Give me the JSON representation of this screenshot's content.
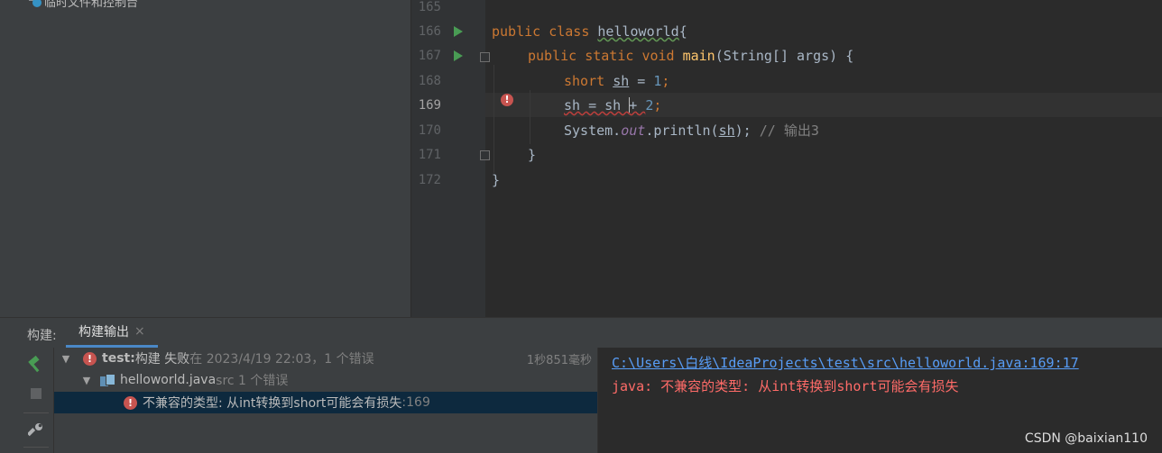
{
  "project": {
    "node_label": "临时文件和控制台"
  },
  "editor": {
    "line_numbers": [
      "165",
      "166",
      "167",
      "168",
      "169",
      "170",
      "171",
      "172"
    ],
    "current_line": "169",
    "lines": {
      "l166": {
        "kw1": "public",
        "kw2": "class",
        "name": "helloworld",
        "brace": "{"
      },
      "l167": {
        "kw1": "public",
        "kw2": "static",
        "kw3": "void",
        "fn": "main",
        "rest": "(String[] args) {"
      },
      "l168": {
        "kw": "short",
        "var": "sh",
        "eq": " = ",
        "num": "1",
        "semi": ";"
      },
      "l169": {
        "var1": "sh",
        "mid": " = sh ",
        "op": "+ ",
        "num": "2",
        "semi": ";"
      },
      "l170": {
        "obj": "System.",
        "field": "out",
        "call": ".println(",
        "arg": "sh",
        "close": ");",
        "comment": " // 输出3"
      },
      "l171": {
        "text": "}"
      },
      "l172": {
        "text": "}"
      }
    }
  },
  "bottom_panel": {
    "title": "构建:",
    "tab_label": "构建输出",
    "tab_close": "×",
    "tree": {
      "root": {
        "name": "test:",
        "status": " 构建 失败",
        "detail": " 在 2023/4/19 22:03，1 个错误",
        "duration": "1秒851毫秒"
      },
      "file": {
        "name": "helloworld.java",
        "detail": " src 1 个错误"
      },
      "error": {
        "message": "不兼容的类型: 从int转换到short可能会有损失",
        "line": " :169"
      }
    },
    "console": {
      "link": "C:\\Users\\白线\\IdeaProjects\\test\\src\\helloworld.java:169:17",
      "error": "java: 不兼容的类型: 从int转换到short可能会有损失"
    }
  },
  "watermark": "CSDN @baixian110",
  "colors": {
    "accent": "#4a88c7",
    "error": "#c75450",
    "run": "#499c54",
    "link": "#589df6"
  }
}
